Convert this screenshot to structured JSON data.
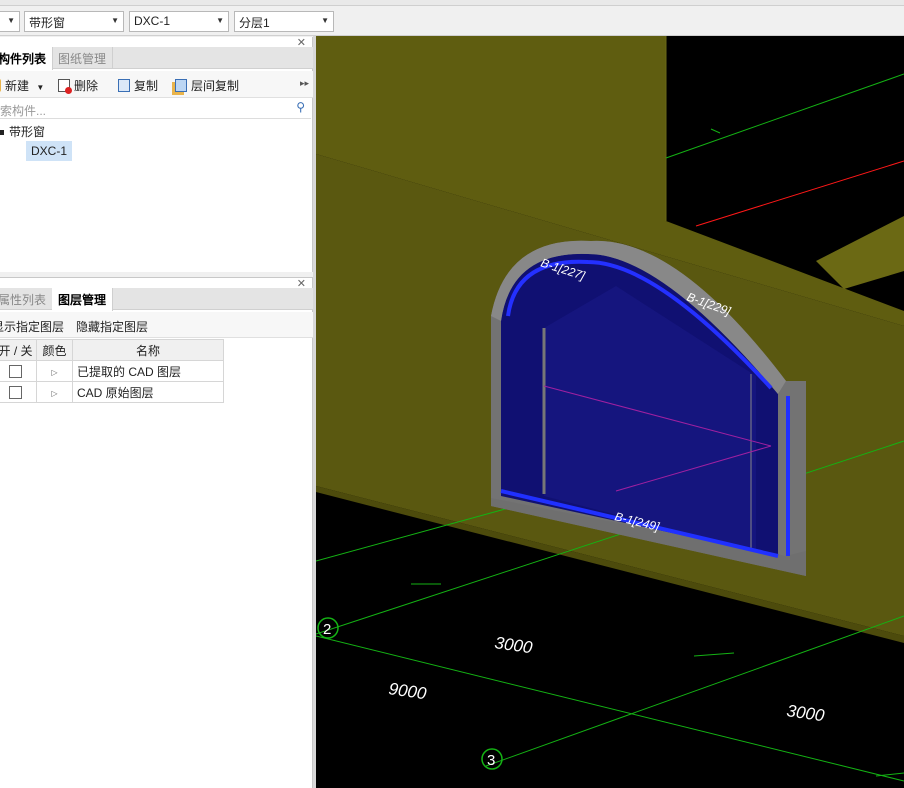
{
  "toolbar": {
    "combo1_value": "带形窗",
    "combo2_value": "DXC-1",
    "combo3_value": "分层1"
  },
  "component_panel": {
    "tabs": [
      "构件列表",
      "图纸管理"
    ],
    "actions": {
      "new": "新建",
      "delete": "删除",
      "copy": "复制",
      "floor_copy": "层间复制"
    },
    "search_placeholder": "搜索构件...",
    "tree": {
      "root": "带形窗",
      "child": "DXC-1"
    }
  },
  "layer_panel": {
    "tabs": [
      "属性列表",
      "图层管理"
    ],
    "actions": {
      "show": "显示指定图层",
      "hide": "隐藏指定图层"
    },
    "table": {
      "headers": [
        "开 / 关",
        "颜色",
        "名称"
      ],
      "rows": [
        {
          "name": "已提取的 CAD 图层"
        },
        {
          "name": "CAD 原始图层"
        }
      ]
    }
  },
  "viewport": {
    "axis_labels": [
      "2",
      "3"
    ],
    "dimensions": [
      "3000",
      "9000",
      "3000"
    ],
    "edge_labels": [
      "B-1[227]",
      "B-1[229]",
      "B-1[249]"
    ]
  },
  "colors": {
    "wall": "#5f5d10",
    "glass": "#101072",
    "frame": "#727272",
    "grid": "#14b214",
    "axis_red": "#ff1818"
  }
}
